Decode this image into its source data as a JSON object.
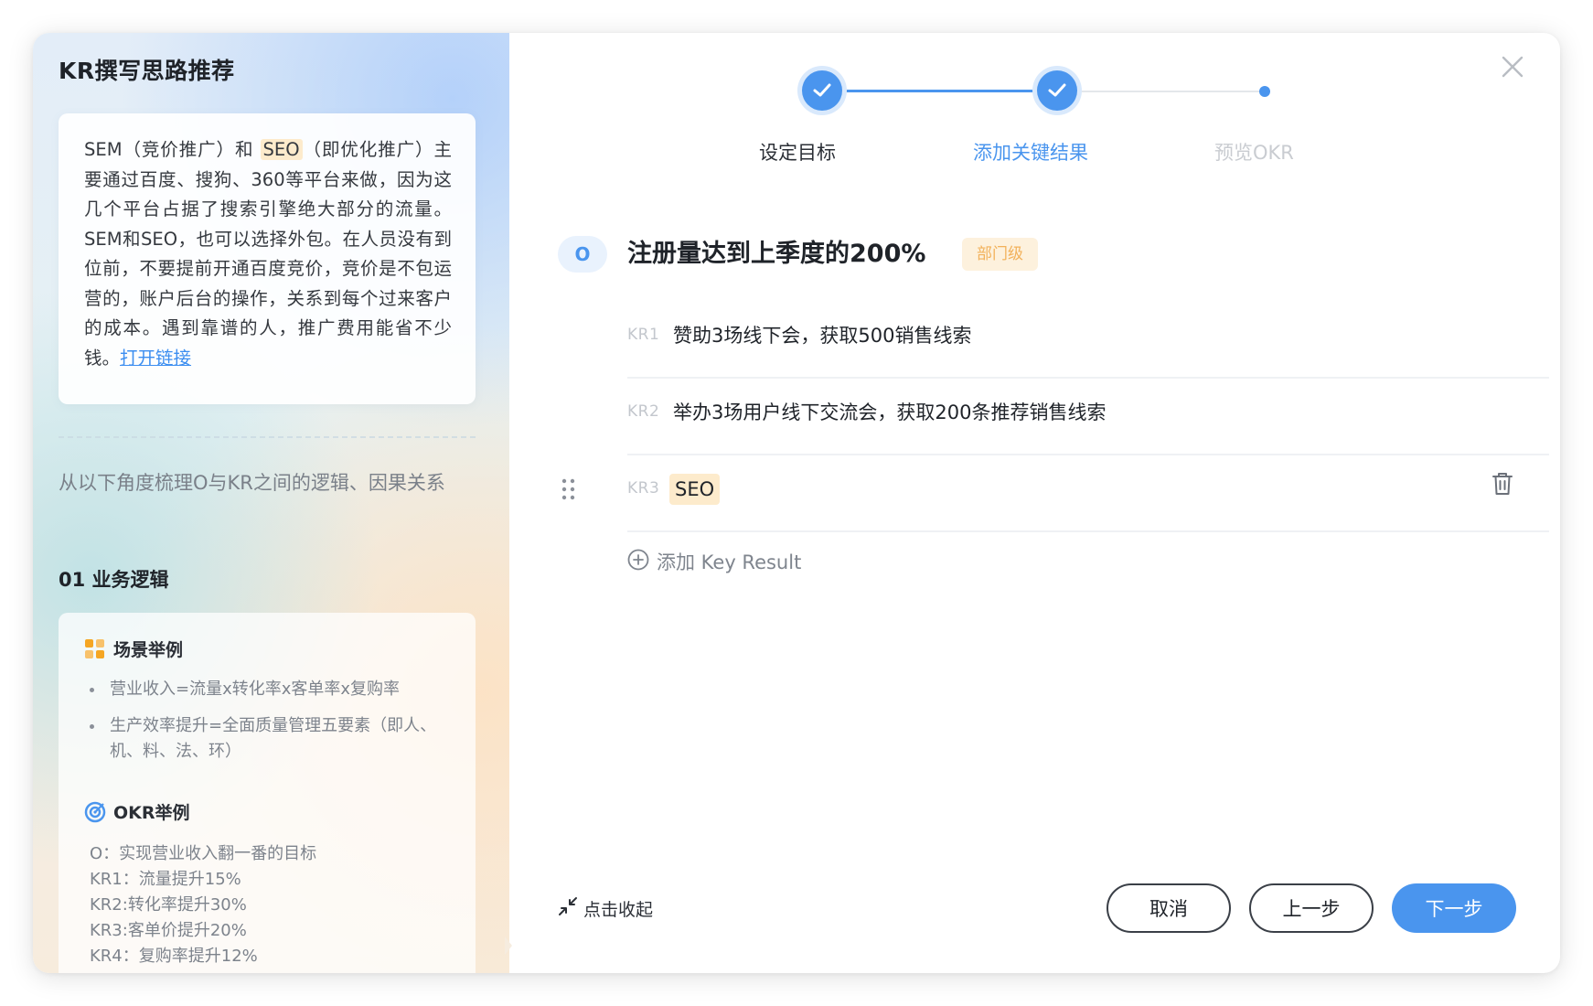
{
  "left": {
    "title": "KR撰写思路推荐",
    "card": {
      "prefix": "SEM（竞价推广）和 ",
      "highlight": "SEO",
      "body": "（即优化推广）主要通过百度、搜狗、360等平台来做，因为这几个平台占据了搜索引擎绝大部分的流量。SEM和SEO，也可以选择外包。在人员没有到位前，不要提前开通百度竞价，竞价是不包运营的，账户后台的操作，关系到每个过来客户的成本。遇到靠谱的人，推广费用能省不少钱。",
      "link": "打开链接"
    },
    "hint": "从以下角度梳理O与KR之间的逻辑、因果关系",
    "section_title": "01 业务逻辑",
    "scene": {
      "title": "场景举例",
      "icon": "grid-icon",
      "bullets": [
        "营业收入=流量x转化率x客单率x复购率",
        "生产效率提升=全面质量管理五要素（即人、机、料、法、环）"
      ]
    },
    "okr_example": {
      "title": "OKR举例",
      "icon": "target-icon",
      "lines": [
        "O：实现营业收入翻一番的目标",
        "KR1：流量提升15%",
        "KR2:转化率提升30%",
        "KR3:客单价提升20%",
        "KR4：复购率提升12%"
      ]
    }
  },
  "steps": [
    {
      "label": "设定目标",
      "state": "done"
    },
    {
      "label": "添加关键结果",
      "state": "active"
    },
    {
      "label": "预览OKR",
      "state": "pending"
    }
  ],
  "colors": {
    "primary": "#4a95ee",
    "step_pending_text": "#c9ccd1",
    "tag_bg": "#fdf1dd",
    "tag_text": "#f2b15a"
  },
  "objective": {
    "badge": "O",
    "title": "注册量达到上季度的200%",
    "level_tag": "部门级"
  },
  "key_results": [
    {
      "label": "KR1",
      "text": "赞助3场线下会，获取500销售线索"
    },
    {
      "label": "KR2",
      "text": "举办3场用户线下交流会，获取200条推荐销售线索"
    },
    {
      "label": "KR3",
      "text": "SEO"
    }
  ],
  "add_kr_label": "添加 Key Result",
  "collapse_label": "点击收起",
  "buttons": {
    "cancel": "取消",
    "prev": "上一步",
    "next": "下一步"
  }
}
